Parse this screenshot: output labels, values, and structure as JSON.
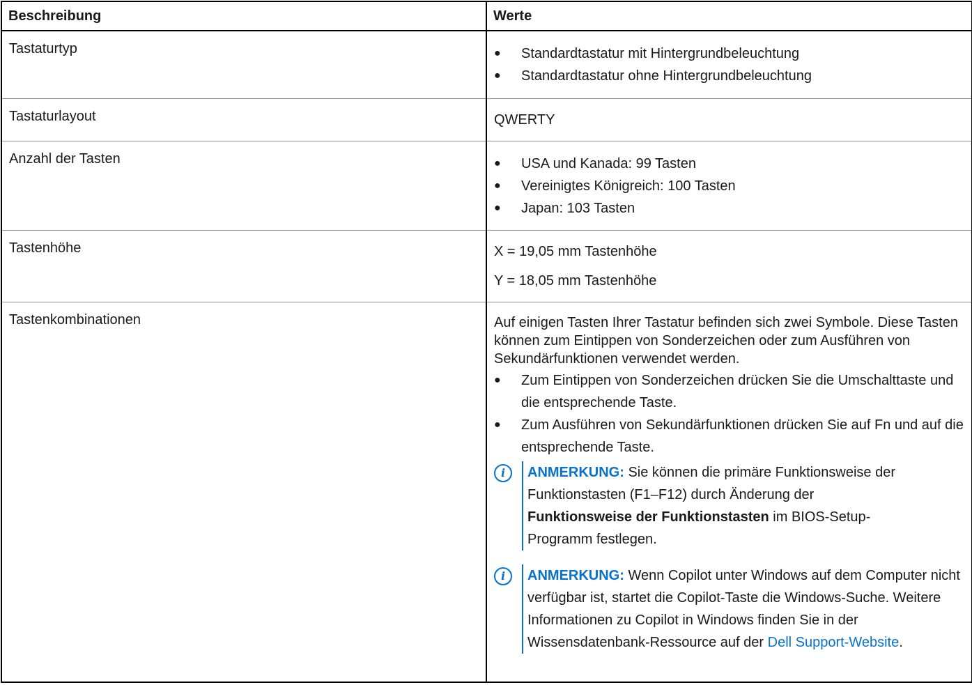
{
  "headers": {
    "col1": "Beschreibung",
    "col2": "Werte"
  },
  "rows": [
    {
      "label": "Tastaturtyp",
      "bullets": [
        "Standardtastatur mit Hintergrundbeleuchtung",
        "Standardtastatur ohne Hintergrundbeleuchtung"
      ]
    },
    {
      "label": "Tastaturlayout",
      "value": "QWERTY"
    },
    {
      "label": "Anzahl der Tasten",
      "bullets": [
        "USA und Kanada: 99 Tasten",
        "Vereinigtes Königreich: 100 Tasten",
        "Japan: 103 Tasten"
      ]
    },
    {
      "label": "Tastenhöhe",
      "lines": [
        "X = 19,05 mm Tastenhöhe",
        "Y = 18,05 mm Tastenhöhe"
      ]
    },
    {
      "label": "Tastenkombinationen",
      "intro": "Auf einigen Tasten Ihrer Tastatur befinden sich zwei Symbole. Diese Tasten können zum Eintippen von Sonderzeichen oder zum Ausführen von Sekundärfunktionen verwendet werden.",
      "bullets": [
        "Zum Eintippen von Sonderzeichen drücken Sie die Umschalttaste und die entsprechende Taste.",
        "Zum Ausführen von Sekundärfunktionen drücken Sie auf Fn und auf die entsprechende Taste."
      ],
      "notes": [
        {
          "label": "ANMERKUNG:",
          "text_before": "Sie können die primäre Funktionsweise der Funktionstasten (F1–F12) durch Änderung der",
          "bold": "Funktionsweise der Funktionstasten",
          "text_after": "im BIOS-Setup-Programm festlegen."
        },
        {
          "label": "ANMERKUNG:",
          "text_before": "Wenn Copilot unter Windows auf dem Computer nicht verfügbar ist, startet die Copilot-Taste die Windows-Suche. Weitere Informationen zu Copilot in Windows finden Sie in der Wissensdatenbank-Ressource auf der",
          "link": "Dell Support-Website",
          "text_after": "."
        }
      ]
    }
  ],
  "icon": "info-icon",
  "accent_color": "#0672cb"
}
